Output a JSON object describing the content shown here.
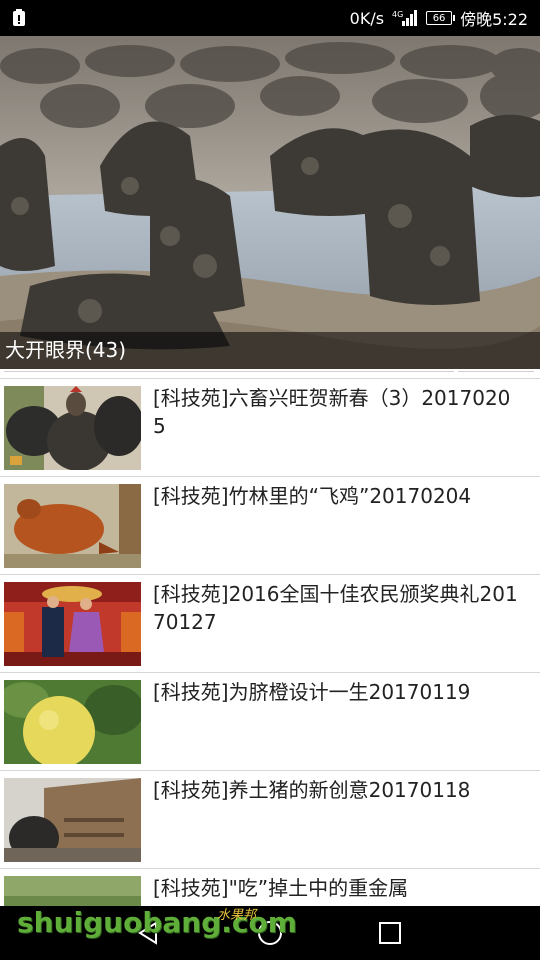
{
  "status_bar": {
    "network_speed": "0K/s",
    "network_type": "4G",
    "battery": "66",
    "time": "傍晚5:22"
  },
  "banner": {
    "caption": "大开眼界(43)"
  },
  "videos": [
    {
      "title": "[科技苑]六畜兴旺贺新春（3）20170205",
      "thumbnail": "rooster"
    },
    {
      "title": "[科技苑]竹林里的“飞鸡”20170204",
      "thumbnail": "brown-chicken"
    },
    {
      "title": "[科技苑]2016全国十佳农民颁奖典礼20170127",
      "thumbnail": "award-stage"
    },
    {
      "title": "[科技苑]为脐橙设计一生20170119",
      "thumbnail": "navel-orange"
    },
    {
      "title": "[科技苑]养土猪的新创意20170118",
      "thumbnail": "pig-shed"
    },
    {
      "title": "[科技苑]\"吃”掉土中的重金属",
      "thumbnail": "grass-field"
    }
  ],
  "nav_bar": {
    "buttons": [
      "back-icon",
      "home-icon",
      "recents-icon"
    ]
  },
  "watermark": {
    "text": "shuiguobang.com",
    "cn_text": "水果邦"
  }
}
